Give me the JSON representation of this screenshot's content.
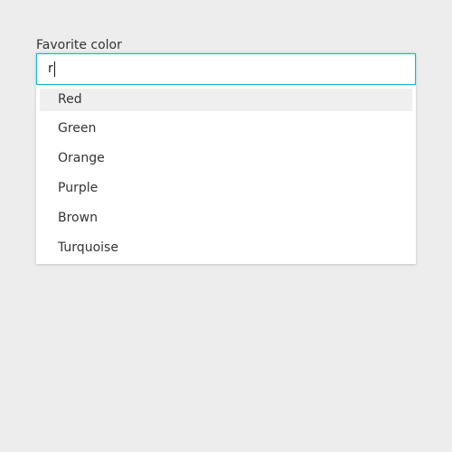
{
  "field": {
    "label": "Favorite color",
    "value": "r",
    "accent_color": "#13b9c9"
  },
  "listbox": {
    "active_index": 0,
    "options": [
      {
        "label": "Red"
      },
      {
        "label": "Green"
      },
      {
        "label": "Orange"
      },
      {
        "label": "Purple"
      },
      {
        "label": "Brown"
      },
      {
        "label": "Turquoise"
      }
    ]
  }
}
